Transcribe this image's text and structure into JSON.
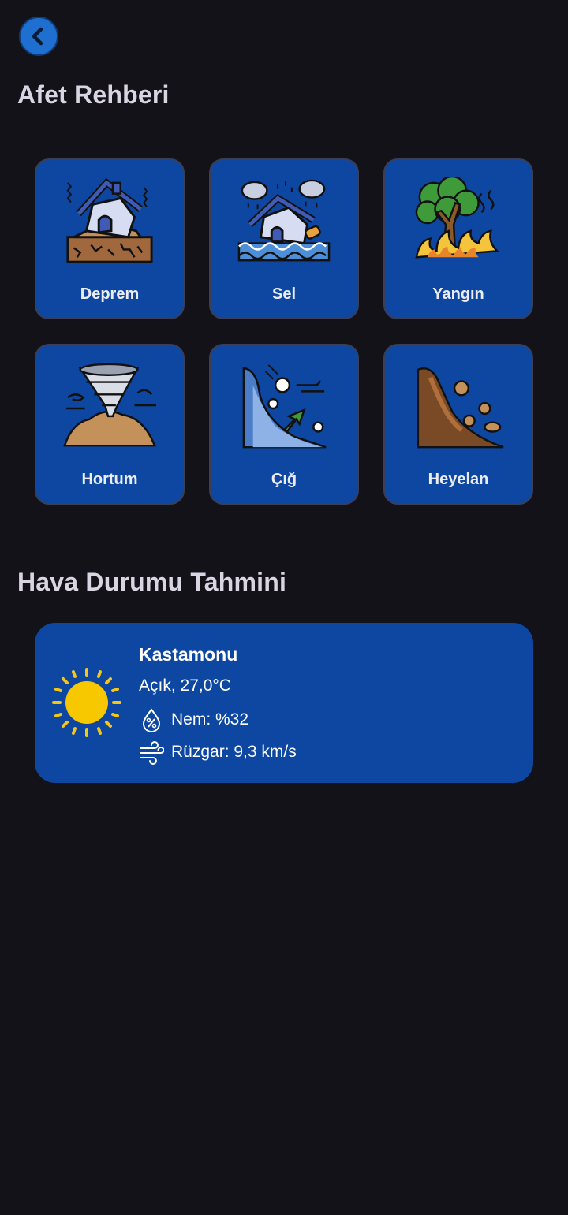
{
  "header": {
    "back_icon": "chevron-left-icon"
  },
  "guide": {
    "title": "Afet Rehberi",
    "items": [
      {
        "label": "Deprem",
        "icon": "earthquake-icon"
      },
      {
        "label": "Sel",
        "icon": "flood-icon"
      },
      {
        "label": "Yangın",
        "icon": "wildfire-icon"
      },
      {
        "label": "Hortum",
        "icon": "tornado-icon"
      },
      {
        "label": "Çığ",
        "icon": "avalanche-icon"
      },
      {
        "label": "Heyelan",
        "icon": "landslide-icon"
      }
    ]
  },
  "weather": {
    "title": "Hava Durumu Tahmini",
    "city": "Kastamonu",
    "condition": "Açık, 27,0°C",
    "humidity": "Nem: %32",
    "wind": "Rüzgar: 9,3 km/s",
    "icon": "sun-icon"
  },
  "colors": {
    "background": "#141219",
    "card": "#0d47a1",
    "accent": "#1e6fd0"
  }
}
